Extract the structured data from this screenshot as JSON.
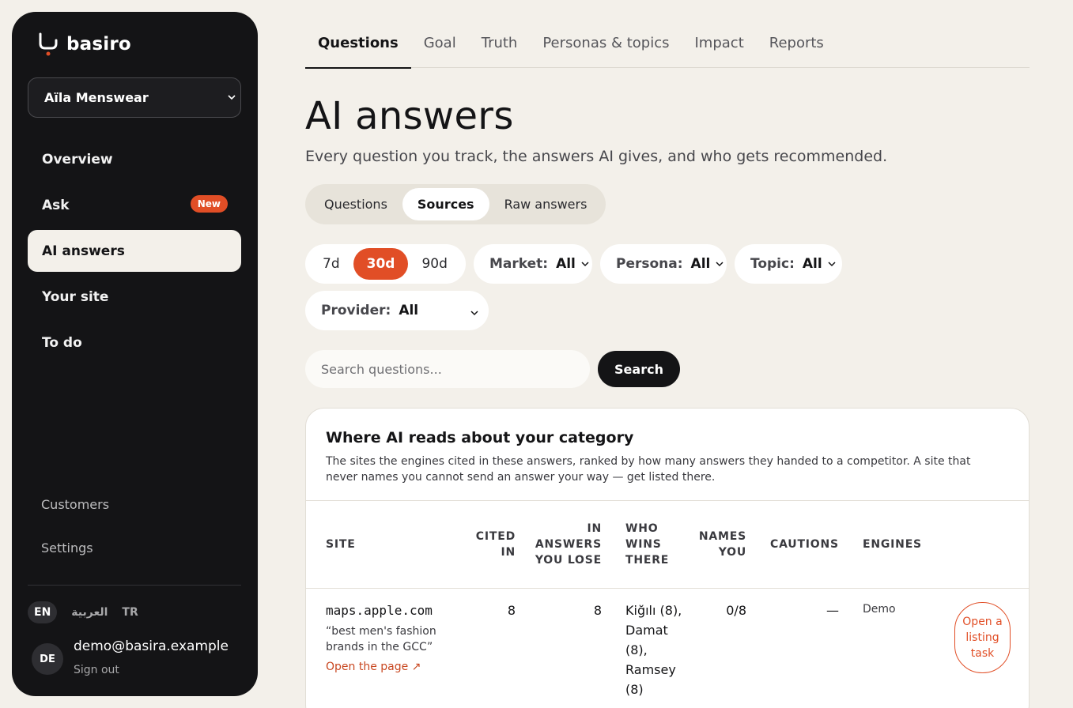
{
  "brand": {
    "name": "basiro",
    "accent": "#e14e26"
  },
  "workspace": {
    "name": "Aïla Menswear"
  },
  "sidebar": {
    "items": [
      {
        "label": "Overview"
      },
      {
        "label": "Ask",
        "badge": "New"
      },
      {
        "label": "AI answers",
        "active": true
      },
      {
        "label": "Your site"
      },
      {
        "label": "To do"
      }
    ],
    "secondary": [
      {
        "label": "Customers"
      },
      {
        "label": "Settings"
      }
    ],
    "languages": [
      "EN",
      "العربية",
      "TR"
    ],
    "user": {
      "initials": "DE",
      "email": "demo@basira.example",
      "sign_out": "Sign out"
    }
  },
  "tabs": [
    "Questions",
    "Goal",
    "Truth",
    "Personas & topics",
    "Impact",
    "Reports"
  ],
  "page": {
    "title": "AI answers",
    "subtitle": "Every question you track, the answers AI gives, and who gets recommended."
  },
  "views": [
    "Questions",
    "Sources",
    "Raw answers"
  ],
  "filters": {
    "ranges": [
      "7d",
      "30d",
      "90d"
    ],
    "market": {
      "label": "Market:",
      "value": "All"
    },
    "persona": {
      "label": "Persona:",
      "value": "All"
    },
    "topic": {
      "label": "Topic:",
      "value": "All"
    },
    "provider": {
      "label": "Provider:",
      "value": "All"
    }
  },
  "search": {
    "placeholder": "Search questions...",
    "button": "Search"
  },
  "sources_card": {
    "title": "Where AI reads about your category",
    "description": "The sites the engines cited in these answers, ranked by how many answers they handed to a competitor. A site that never names you cannot send an answer your way — get listed there.",
    "columns": [
      "Site",
      "Cited in",
      "In answers you lose",
      "Who wins there",
      "Names you",
      "Cautions",
      "Engines"
    ],
    "rows": [
      {
        "site": "maps.apple.com",
        "question": "“best men's fashion brands in the GCC”",
        "link": "Open the page ↗",
        "cited_in": "8",
        "in_answers_you_lose": "8",
        "who_wins": [
          "Kiğılı (8),",
          "Damat (8),",
          "Ramsey (8)"
        ],
        "names_you": "0/8",
        "cautions": "—",
        "engines": "Demo",
        "action": "Open a listing task"
      }
    ]
  }
}
